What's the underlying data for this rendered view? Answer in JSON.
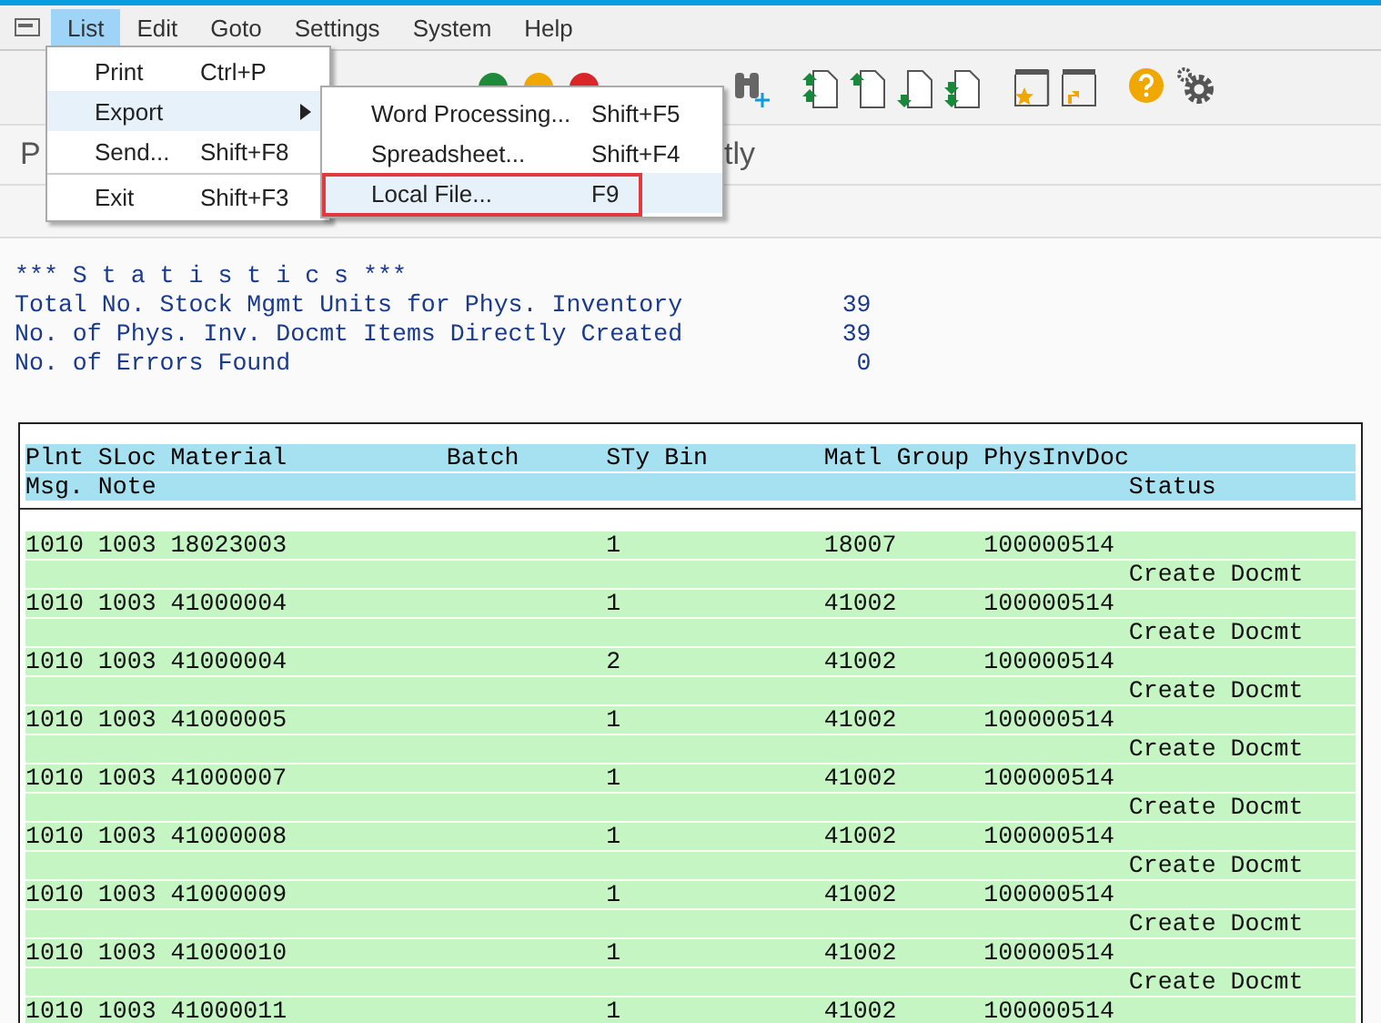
{
  "menu_bar": [
    {
      "label": "List",
      "selected": true
    },
    {
      "label": "Edit",
      "selected": false
    },
    {
      "label": "Goto",
      "selected": false
    },
    {
      "label": "Settings",
      "selected": false
    },
    {
      "label": "System",
      "selected": false
    },
    {
      "label": "Help",
      "selected": false
    }
  ],
  "list_menu": [
    {
      "label": "Print",
      "shortcut": "Ctrl+P",
      "selected": false,
      "submenu": false,
      "separator_before": false
    },
    {
      "label": "Export",
      "selected": true,
      "submenu": true,
      "separator_before": false
    },
    {
      "label": "Send...",
      "shortcut": "Shift+F8",
      "selected": false,
      "submenu": false,
      "separator_before": false
    },
    {
      "label": "Exit",
      "shortcut": "Shift+F3",
      "selected": false,
      "submenu": false,
      "separator_before": true
    }
  ],
  "export_submenu": [
    {
      "label": "Word Processing...",
      "shortcut": "Shift+F5",
      "selected": false
    },
    {
      "label": "Spreadsheet...",
      "shortcut": "Shift+F4",
      "selected": false
    },
    {
      "label": "Local File...",
      "shortcut": "F9",
      "selected": true,
      "outlined": true
    }
  ],
  "title_fragments": [
    "P",
    "tly"
  ],
  "statistics": {
    "heading": "*** S t a t i s t i c s ***",
    "lines": [
      {
        "label": "Total No. Stock Mgmt Units for Phys. Inventory",
        "value": "39"
      },
      {
        "label": "No. of Phys. Inv. Docmt Items Directly Created",
        "value": "39"
      },
      {
        "label": "No. of Errors Found",
        "value": "0"
      }
    ]
  },
  "table": {
    "header_line_1": [
      "Plnt",
      "SLoc",
      "Material",
      "Batch",
      "STy",
      "Bin",
      "Matl Group",
      "PhysInvDoc"
    ],
    "header_line_2": [
      "Msg.",
      "Note",
      "Status"
    ],
    "rows": [
      {
        "plant": "1010",
        "sloc": "1003",
        "material": "18023003",
        "sty": "1",
        "matl_group": "18007",
        "phys_inv_doc": "100000514",
        "status": "Create Docmt"
      },
      {
        "plant": "1010",
        "sloc": "1003",
        "material": "41000004",
        "sty": "1",
        "matl_group": "41002",
        "phys_inv_doc": "100000514",
        "status": "Create Docmt"
      },
      {
        "plant": "1010",
        "sloc": "1003",
        "material": "41000004",
        "sty": "2",
        "matl_group": "41002",
        "phys_inv_doc": "100000514",
        "status": "Create Docmt"
      },
      {
        "plant": "1010",
        "sloc": "1003",
        "material": "41000005",
        "sty": "1",
        "matl_group": "41002",
        "phys_inv_doc": "100000514",
        "status": "Create Docmt"
      },
      {
        "plant": "1010",
        "sloc": "1003",
        "material": "41000007",
        "sty": "1",
        "matl_group": "41002",
        "phys_inv_doc": "100000514",
        "status": "Create Docmt"
      },
      {
        "plant": "1010",
        "sloc": "1003",
        "material": "41000008",
        "sty": "1",
        "matl_group": "41002",
        "phys_inv_doc": "100000514",
        "status": "Create Docmt"
      },
      {
        "plant": "1010",
        "sloc": "1003",
        "material": "41000009",
        "sty": "1",
        "matl_group": "41002",
        "phys_inv_doc": "100000514",
        "status": "Create Docmt"
      },
      {
        "plant": "1010",
        "sloc": "1003",
        "material": "41000010",
        "sty": "1",
        "matl_group": "41002",
        "phys_inv_doc": "100000514",
        "status": "Create Docmt"
      },
      {
        "plant": "1010",
        "sloc": "1003",
        "material": "41000011",
        "sty": "1",
        "matl_group": "41002",
        "phys_inv_doc": "100000514"
      }
    ]
  }
}
